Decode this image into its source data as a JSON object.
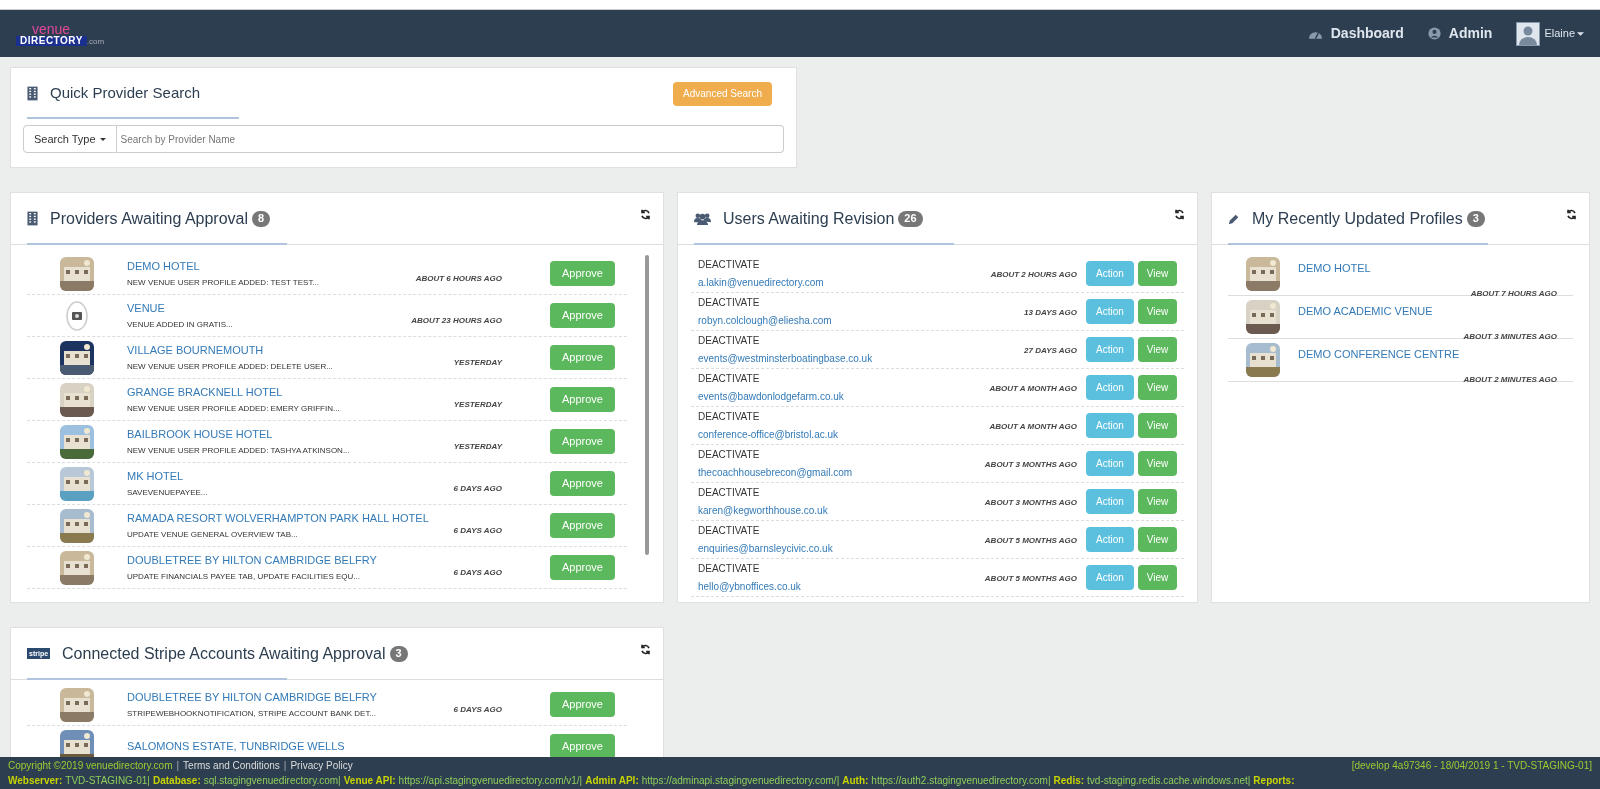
{
  "header": {
    "logo_top": "venue",
    "logo_bottom": "DIRECTORY",
    "logo_suffix": ".com",
    "nav": [
      {
        "label": "Dashboard",
        "kind": "dashboard"
      },
      {
        "label": "Admin",
        "kind": "admin"
      }
    ],
    "user": "Elaine"
  },
  "quick_search": {
    "title": "Quick Provider Search",
    "advanced_button": "Advanced Search",
    "search_type": "Search Type",
    "placeholder": "Search by Provider Name"
  },
  "providers": {
    "title": "Providers Awaiting Approval",
    "count": "8",
    "items": [
      {
        "name": "DEMO HOTEL",
        "description": "NEW VENUE USER PROFILE ADDED: TEST TEST...",
        "time": "ABOUT 6 HOURS AGO",
        "button": "Approve"
      },
      {
        "name": "VENUE",
        "description": "VENUE ADDED IN GRATIS...",
        "time": "ABOUT 23 HOURS AGO",
        "kind": "placeholder",
        "button": "Approve"
      },
      {
        "name": "VILLAGE BOURNEMOUTH",
        "description": "NEW VENUE USER PROFILE ADDED: DELETE USER...",
        "time": "YESTERDAY",
        "button": "Approve"
      },
      {
        "name": "GRANGE BRACKNELL HOTEL",
        "description": "NEW VENUE USER PROFILE ADDED: EMERY GRIFFIN...",
        "time": "YESTERDAY",
        "button": "Approve"
      },
      {
        "name": "BAILBROOK HOUSE HOTEL",
        "description": "NEW VENUE USER PROFILE ADDED: TASHYA ATKINSON...",
        "time": "YESTERDAY",
        "button": "Approve"
      },
      {
        "name": "MK HOTEL",
        "description": "SAVEVENUEPAYEE...",
        "time": "6 DAYS AGO",
        "button": "Approve"
      },
      {
        "name": "RAMADA RESORT WOLVERHAMPTON PARK HALL HOTEL",
        "description": "UPDATE VENUE GENERAL OVERVIEW TAB...",
        "time": "6 DAYS AGO",
        "button": "Approve"
      },
      {
        "name": "DOUBLETREE BY HILTON CAMBRIDGE BELFRY",
        "description": "UPDATE FINANCIALS PAYEE TAB, UPDATE FACILITIES EQU...",
        "time": "6 DAYS AGO",
        "button": "Approve"
      }
    ]
  },
  "users": {
    "title": "Users Awaiting Revision",
    "count": "26",
    "items": [
      {
        "status": "DEACTIVATE",
        "email": "a.lakin@venuedirectory.com",
        "time": "ABOUT 2 HOURS AGO",
        "action": "Action",
        "view": "View"
      },
      {
        "status": "DEACTIVATE",
        "email": "robyn.colclough@eliesha.com",
        "time": "13 DAYS AGO",
        "action": "Action",
        "view": "View"
      },
      {
        "status": "DEACTIVATE",
        "email": "events@westminsterboatingbase.co.uk",
        "time": "27 DAYS AGO",
        "action": "Action",
        "view": "View"
      },
      {
        "status": "DEACTIVATE",
        "email": "events@bawdonlodgefarm.co.uk",
        "time": "ABOUT A MONTH AGO",
        "action": "Action",
        "view": "View"
      },
      {
        "status": "DEACTIVATE",
        "email": "conference-office@bristol.ac.uk",
        "time": "ABOUT A MONTH AGO",
        "action": "Action",
        "view": "View"
      },
      {
        "status": "DEACTIVATE",
        "email": "thecoachhousebrecon@gmail.com",
        "time": "ABOUT 3 MONTHS AGO",
        "action": "Action",
        "view": "View"
      },
      {
        "status": "DEACTIVATE",
        "email": "karen@kegworthhouse.co.uk",
        "time": "ABOUT 3 MONTHS AGO",
        "action": "Action",
        "view": "View"
      },
      {
        "status": "DEACTIVATE",
        "email": "enquiries@barnsleycivic.co.uk",
        "time": "ABOUT 5 MONTHS AGO",
        "action": "Action",
        "view": "View"
      },
      {
        "status": "DEACTIVATE",
        "email": "hello@ybnoffices.co.uk",
        "time": "ABOUT 5 MONTHS AGO",
        "action": "Action",
        "view": "View"
      }
    ]
  },
  "recent": {
    "title": "My Recently Updated Profiles",
    "count": "3",
    "items": [
      {
        "name": "DEMO HOTEL",
        "time": "ABOUT 7 HOURS AGO"
      },
      {
        "name": "DEMO ACADEMIC VENUE",
        "time": "ABOUT 3 MINUTES AGO"
      },
      {
        "name": "DEMO CONFERENCE CENTRE",
        "time": "ABOUT 2 MINUTES AGO"
      }
    ]
  },
  "stripe": {
    "title": "Connected Stripe Accounts Awaiting Approval",
    "count": "3",
    "logo": "stripe",
    "items": [
      {
        "name": "DOUBLETREE BY HILTON CAMBRIDGE BELFRY",
        "description": "STRIPEWEBHOOKNOTIFICATION, STRIPE ACCOUNT BANK DET...",
        "time": "6 DAYS AGO",
        "button": "Approve"
      },
      {
        "name": "SALOMONS ESTATE, TUNBRIDGE WELLS",
        "button": "Approve"
      }
    ]
  },
  "footer": {
    "copyright": "Copyright ©2019 venuedirectory.com",
    "separator": "|",
    "links": [
      "Terms and Conditions",
      "Privacy Policy"
    ],
    "build": "[develop 4a97346 - 18/04/2019 1 - TVD-STAGING-01]",
    "servers": [
      {
        "label": "Webserver:",
        "value": "TVD-STAGING-01|"
      },
      {
        "label": "Database:",
        "value": "sql.stagingvenuedirectory.com|"
      },
      {
        "label": "Venue API:",
        "value": "https://api.stagingvenuedirectory.com/v1/|"
      },
      {
        "label": "Admin API:",
        "value": "https://adminapi.stagingvenuedirectory.com/|"
      },
      {
        "label": "Auth:",
        "value": "https://auth2.stagingvenuedirectory.com|"
      },
      {
        "label": "Redis:",
        "value": "tvd-staging.redis.cache.windows.net|"
      },
      {
        "label": "Reports:"
      }
    ]
  }
}
